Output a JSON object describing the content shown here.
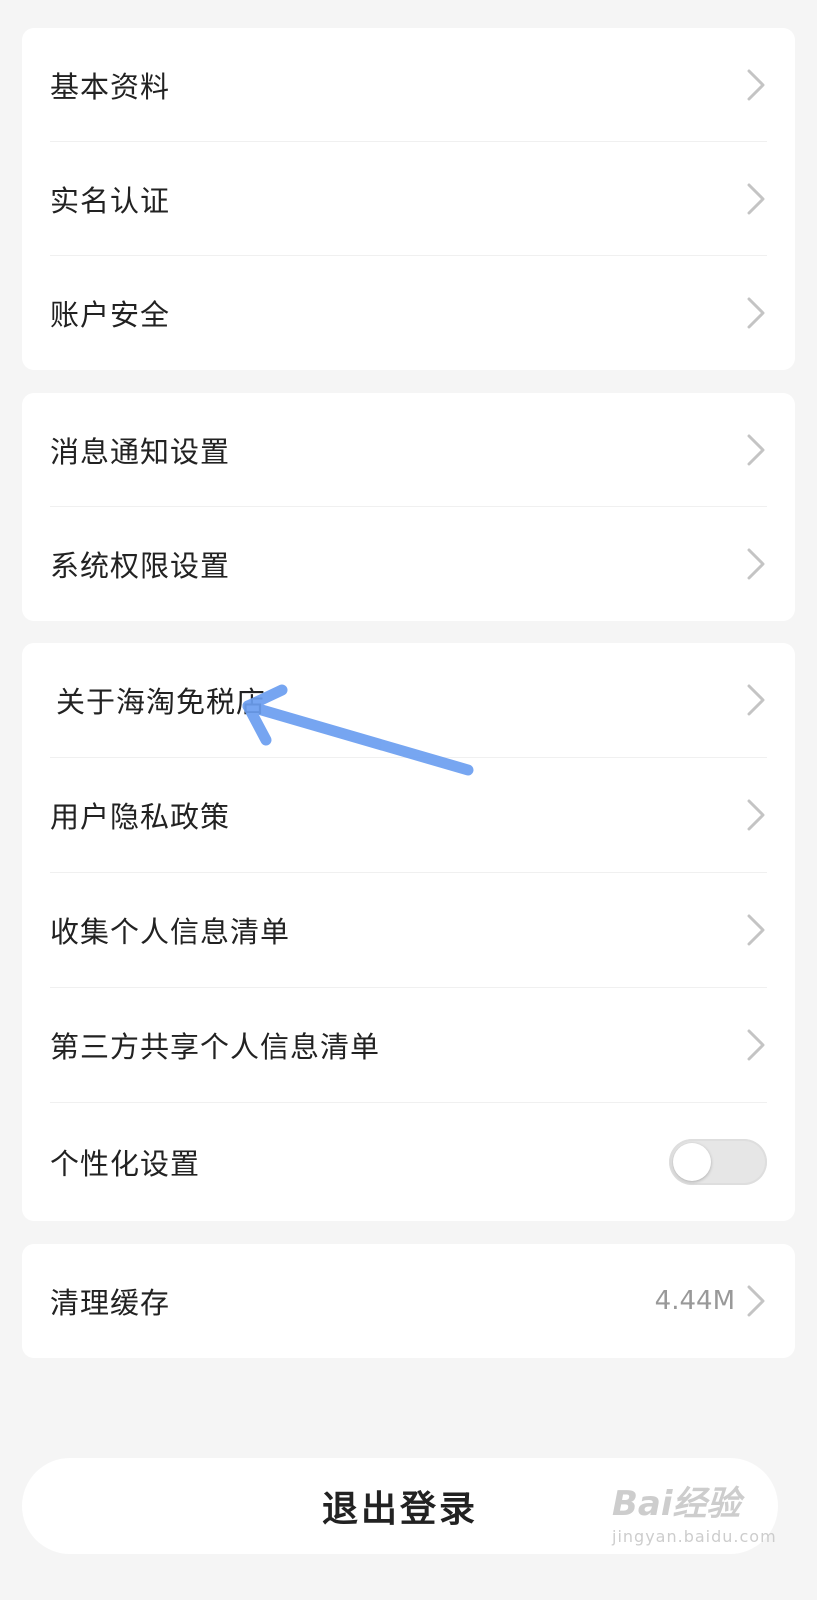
{
  "groups": [
    {
      "items": [
        {
          "label": "基本资料"
        },
        {
          "label": "实名认证"
        },
        {
          "label": "账户安全"
        }
      ]
    },
    {
      "items": [
        {
          "label": "消息通知设置"
        },
        {
          "label": "系统权限设置"
        }
      ]
    },
    {
      "items": [
        {
          "label": "关于海淘免税店"
        },
        {
          "label": "用户隐私政策"
        },
        {
          "label": "收集个人信息清单"
        },
        {
          "label": "第三方共享个人信息清单"
        },
        {
          "label": "个性化设置",
          "toggle_on": false
        }
      ]
    },
    {
      "items": [
        {
          "label": "清理缓存",
          "value": "4.44M"
        }
      ]
    }
  ],
  "logout_label": "退出登录",
  "watermark": {
    "text": "Bai经验",
    "sub": "jingyan.baidu.com"
  },
  "colors": {
    "background": "#f5f5f5",
    "card": "#ffffff",
    "text": "#222222",
    "secondary_text": "#999999",
    "chevron": "#c4c4c4",
    "toggle_off": "#e6e6e6",
    "annotation_arrow": "#6b9ef0"
  },
  "icons": {
    "chevron": "chevron-right-icon",
    "annotation": "arrow-annotation-icon"
  }
}
